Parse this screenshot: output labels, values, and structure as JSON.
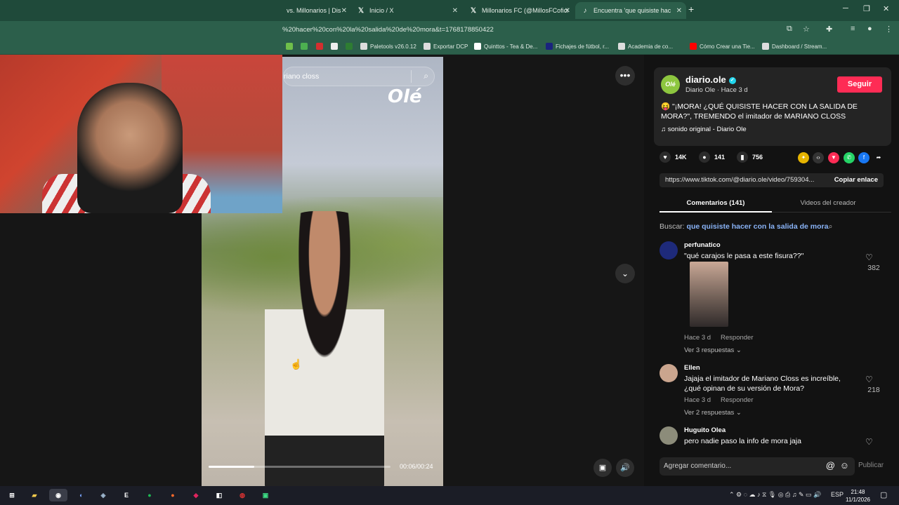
{
  "browser": {
    "tabs": [
      {
        "label": "vs. Millonarios | Dis",
        "icon": "generic-tab-icon",
        "active": false
      },
      {
        "label": "Inicio / X",
        "icon": "x-icon",
        "active": false
      },
      {
        "label": "Millonarios FC (@MillosFCofici",
        "icon": "x-icon",
        "active": false
      },
      {
        "label": "Encuentra 'que quisiste hac",
        "icon": "tiktok-icon",
        "active": true
      }
    ],
    "new_tab": "+",
    "url": "%20hacer%20con%20la%20salida%20de%20mora&t=1768178850422",
    "bookmarks": [
      {
        "label": "",
        "color": "#6fbf4a"
      },
      {
        "label": "",
        "color": "#4caf50"
      },
      {
        "label": "",
        "color": "#d32f2f"
      },
      {
        "label": "",
        "color": "#eeeeee"
      },
      {
        "label": "",
        "color": "#2e7d32"
      },
      {
        "label": "Paletools v26.0.12",
        "color": "#dddddd"
      },
      {
        "label": "Exportar DCP",
        "color": "#dddddd"
      },
      {
        "label": "Quinttos - Tea & De...",
        "color": "#ffffff"
      },
      {
        "label": "Fichajes de fútbol, r...",
        "color": "#1a237e"
      },
      {
        "label": "Academia de co...",
        "color": "#dddddd"
      },
      {
        "label": "Cómo Crear una Tie...",
        "color": "#ff0000"
      },
      {
        "label": "Dashboard / Stream...",
        "color": "#dddddd"
      }
    ]
  },
  "video": {
    "search_text": "riano closs",
    "logo": "Olé",
    "time": "00:06/00:24",
    "progress": 0.25
  },
  "post": {
    "avatar_text": "Olé",
    "account": "diario.ole",
    "subline": "Diario Ole · Hace 3 d",
    "follow_label": "Seguir",
    "description": "😝 \"¡MORA! ¿QUÉ QUISISTE HACER CON LA SALIDA DE MORA?\", TREMENDO el imitador de MARIANO CLOSS",
    "sound": "♫  sonido original - Diario Ole",
    "likes": "14K",
    "comments": "141",
    "saves": "756",
    "link": "https://www.tiktok.com/@diario.ole/video/759304...",
    "copy_label": "Copiar enlace",
    "tab_comments": "Comentarios (141)",
    "tab_creator": "Videos del creador",
    "search_prefix": "Buscar:",
    "search_query": "que quisiste hacer con la salida de mora"
  },
  "comments": [
    {
      "name": "perfunatico",
      "text": "\"qué carajos le pasa a este fisura??\"",
      "time": "Hace 3 d",
      "reply": "Responder",
      "more": "Ver 3 respuestas ⌄",
      "likes": "382",
      "avatar_color": "#1e2a7a"
    },
    {
      "name": "Ellen",
      "text": "Jajaja el imitador de Mariano Closs es increíble, ¿qué opinan de su versión de Mora?",
      "time": "Hace 3 d",
      "reply": "Responder",
      "more": "Ver 2 respuestas ⌄",
      "likes": "218",
      "avatar_color": "#caa58e"
    },
    {
      "name": "Huguito Olea",
      "text": "pero nadie paso la info de mora jaja",
      "avatar_color": "#8c8c7a"
    }
  ],
  "composer": {
    "placeholder": "Agregar comentario...",
    "submit": "Publicar"
  },
  "taskbar": {
    "lang": "ESP",
    "time": "21:48",
    "date": "11/1/2026"
  }
}
